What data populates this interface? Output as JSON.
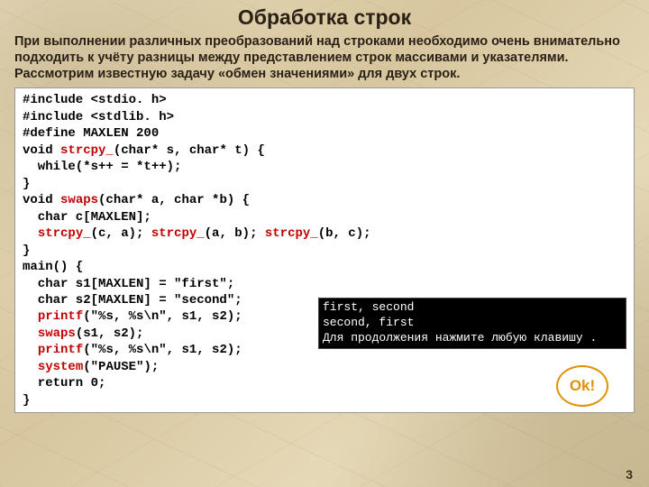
{
  "title": "Обработка строк",
  "intro": "При выполнении различных преобразований над строками необходимо очень внимательно подходить к учёту разницы между представлением строк массивами и указателями.\nРассмотрим известную задачу «обмен значениями» для двух строк.",
  "code": {
    "l1a": "#include ",
    "l1b": "<stdio. h>",
    "l2a": "#include ",
    "l2b": "<stdlib. h>",
    "l3a": "#define ",
    "l3b": "MAXLEN 200",
    "l4a": "void ",
    "l4fn": "strcpy_",
    "l4b": "(char* s, char* t) {",
    "l5": "  while(*s++ = *t++);",
    "l6": "}",
    "l7a": "void ",
    "l7fn": "swaps",
    "l7b": "(char* a, char *b) {",
    "l8": "  char c[MAXLEN];",
    "l9a": "  ",
    "l9f1": "strcpy_",
    "l9b": "(c, a); ",
    "l9f2": "strcpy_",
    "l9c": "(a, b); ",
    "l9f3": "strcpy_",
    "l9d": "(b, c);",
    "l10": "}",
    "l11a": "main",
    "l11b": "() {",
    "l12": "  char s1[MAXLEN] = \"first\";",
    "l13": "  char s2[MAXLEN] = \"second\";",
    "l14a": "  ",
    "l14fn": "printf",
    "l14b": "(\"%s, %s\\n\", s1, s2);",
    "l15a": "  ",
    "l15fn": "swaps",
    "l15b": "(s1, s2);",
    "l16a": "  ",
    "l16fn": "printf",
    "l16b": "(\"%s, %s\\n\", s1, s2);",
    "l17a": "  ",
    "l17fn": "system",
    "l17b": "(\"PAUSE\");",
    "l18": "  return 0;",
    "l19": "}"
  },
  "console": {
    "l1": "first, second",
    "l2": "second, first",
    "l3": "Для продолжения нажмите любую клавишу ."
  },
  "ok": "Ok!",
  "page": "3"
}
